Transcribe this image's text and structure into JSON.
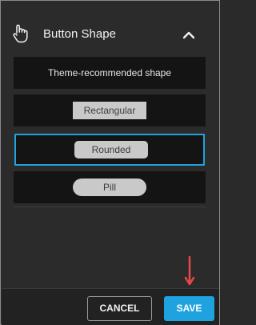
{
  "header": {
    "title": "Button Shape",
    "icon": "hand-pointer-icon",
    "toggle_icon": "chevron-up-icon"
  },
  "options": [
    {
      "label": "Theme-recommended shape",
      "selected": false
    },
    {
      "label": "Rectangular",
      "selected": false
    },
    {
      "label": "Rounded",
      "selected": true
    },
    {
      "label": "Pill",
      "selected": false
    }
  ],
  "footer": {
    "cancel_label": "CANCEL",
    "save_label": "SAVE"
  },
  "annotation": {
    "icon": "arrow-down-icon",
    "color": "#e8474b"
  },
  "colors": {
    "accent": "#1fa3dd",
    "panel": "#2b2b2b",
    "option_bg": "#141414"
  }
}
